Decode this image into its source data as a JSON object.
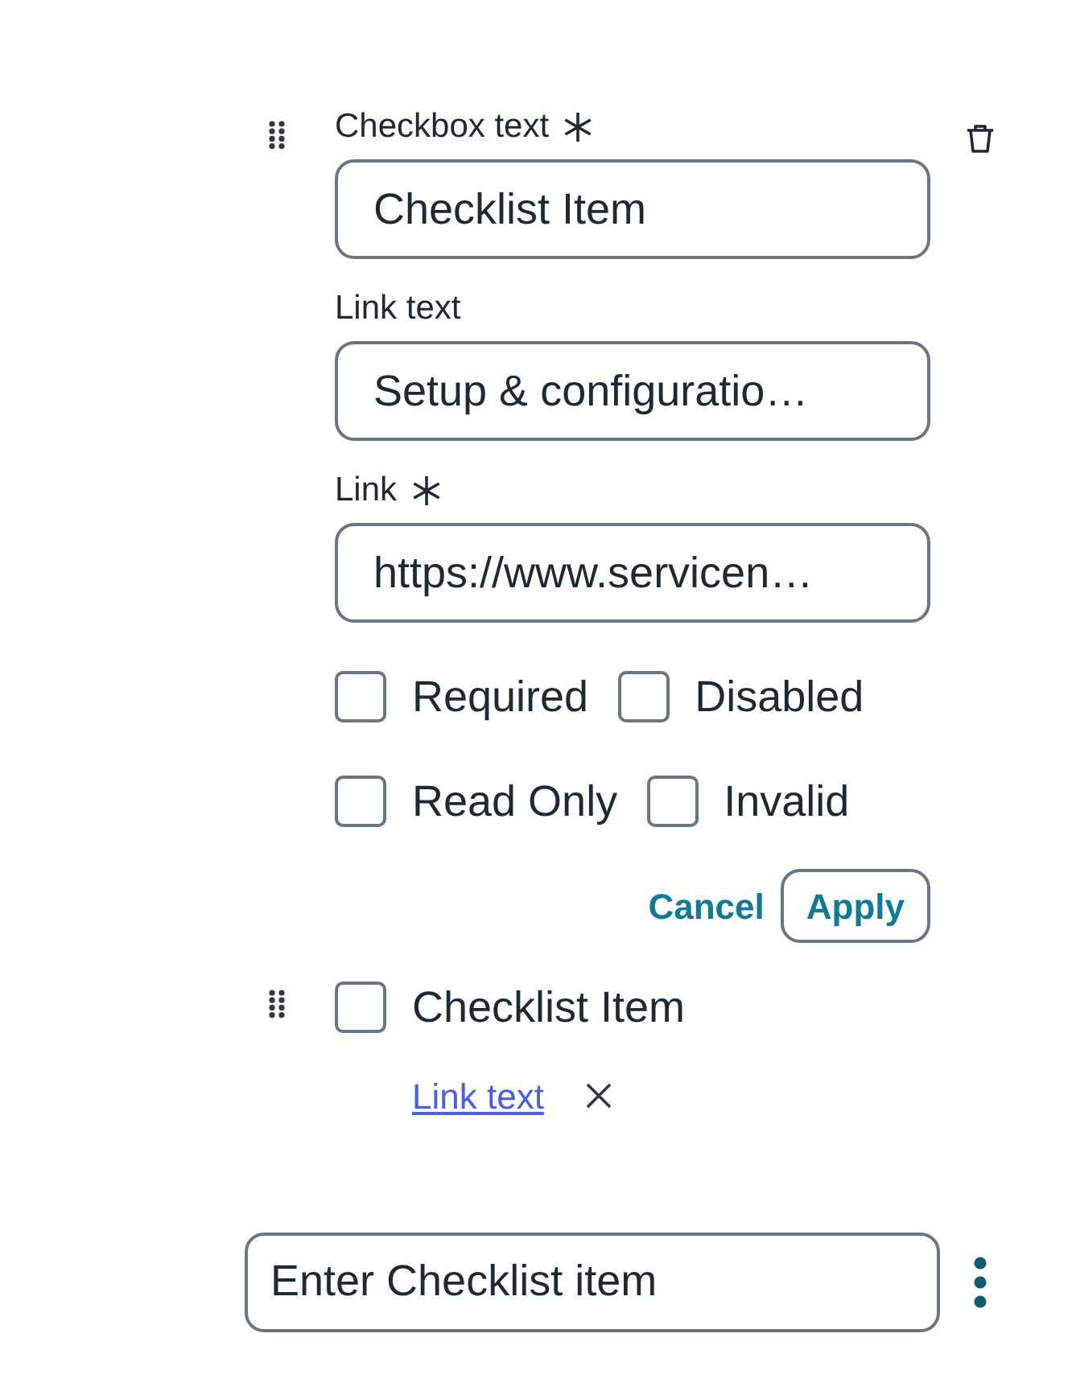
{
  "editor": {
    "fields": [
      {
        "label": "Checkbox text",
        "required": true,
        "value": "Checklist Item"
      },
      {
        "label": "Link text",
        "required": false,
        "value": "Setup & configuratio…"
      },
      {
        "label": "Link",
        "required": true,
        "value": "https://www.servicen…"
      }
    ],
    "options": [
      {
        "label": "Required",
        "checked": false
      },
      {
        "label": "Disabled",
        "checked": false
      },
      {
        "label": "Read Only",
        "checked": false
      },
      {
        "label": "Invalid",
        "checked": false
      }
    ],
    "actions": [
      {
        "label": "Cancel",
        "kind": "text"
      },
      {
        "label": "Apply",
        "kind": "outline"
      }
    ]
  },
  "items": [
    {
      "label": "Checklist Item",
      "checked": false,
      "link": "Link text"
    }
  ],
  "new_item": {
    "placeholder": "Enter Checklist item"
  }
}
